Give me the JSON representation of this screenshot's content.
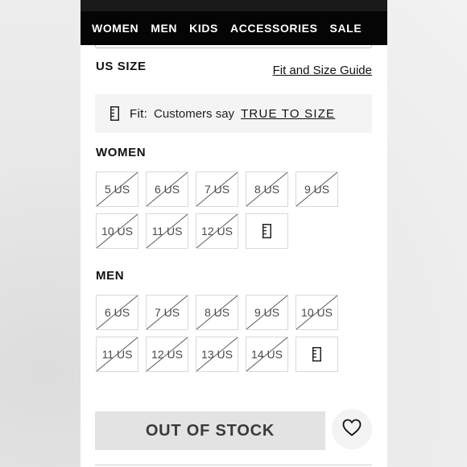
{
  "nav": {
    "items": [
      "WOMEN",
      "MEN",
      "KIDS",
      "ACCESSORIES",
      "SALE"
    ]
  },
  "size_section": {
    "title": "US SIZE",
    "guide_link": "Fit and Size Guide"
  },
  "fit": {
    "label": "Fit:",
    "text": "Customers say",
    "value": "TRUE TO SIZE",
    "icon": "ruler-icon"
  },
  "women": {
    "label": "WOMEN",
    "sizes": [
      "5 US",
      "6 US",
      "7 US",
      "8 US",
      "9 US",
      "10 US",
      "11 US",
      "12 US"
    ],
    "extra_icon": "ruler-icon"
  },
  "men": {
    "label": "MEN",
    "sizes": [
      "6 US",
      "7 US",
      "8 US",
      "9 US",
      "10 US",
      "11 US",
      "12 US",
      "13 US",
      "14 US"
    ],
    "extra_icon": "ruler-icon"
  },
  "actions": {
    "out_of_stock": "OUT OF STOCK",
    "wishlist_icon": "heart-icon"
  }
}
